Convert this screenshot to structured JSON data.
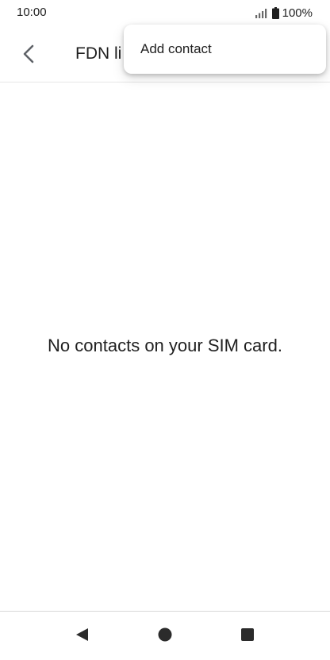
{
  "status_bar": {
    "time": "10:00",
    "battery": "100%",
    "icons": [
      "signal-icon",
      "battery-icon"
    ]
  },
  "app_bar": {
    "title": "FDN li",
    "back_icon": "chevron-left-icon"
  },
  "overflow_menu": {
    "items": [
      {
        "label": "Add contact"
      }
    ]
  },
  "main": {
    "empty_message": "No contacts on your SIM card."
  },
  "nav_bar": {
    "icons": [
      "back-triangle-icon",
      "home-circle-icon",
      "recents-square-icon"
    ]
  },
  "colors": {
    "background": "#ffffff",
    "text": "#1f1f1f",
    "icon": "#5f6368",
    "divider": "#e6e6e6"
  }
}
